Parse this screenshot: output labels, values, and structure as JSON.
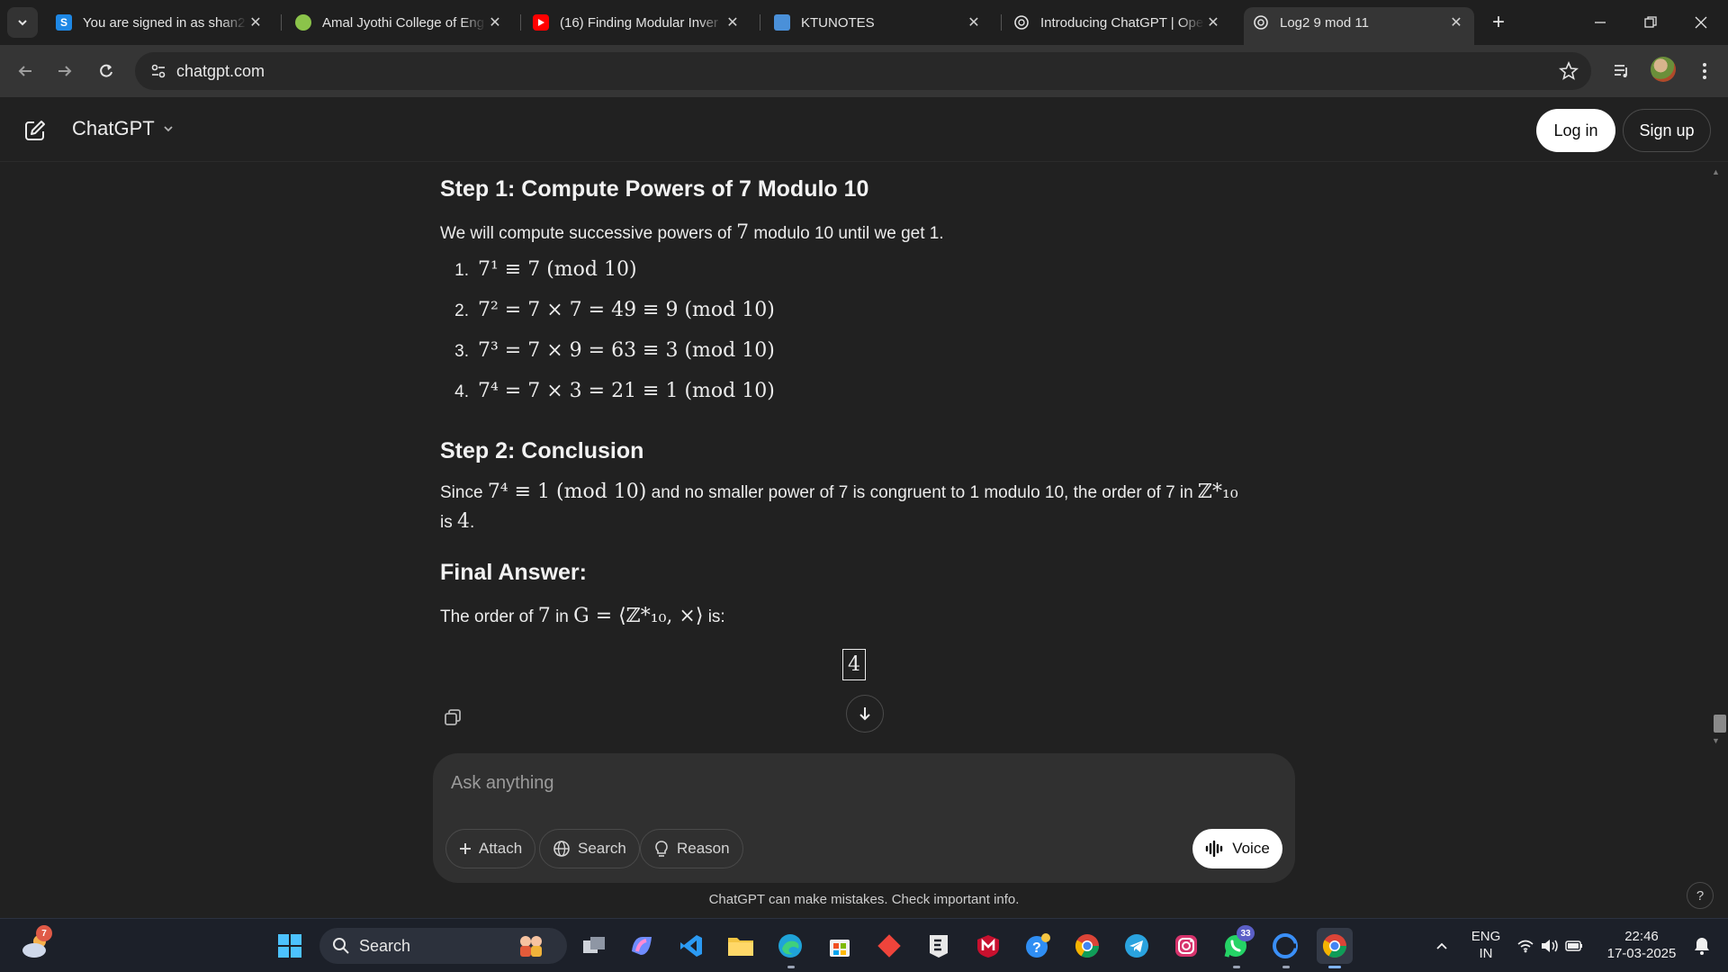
{
  "browser": {
    "tabs": [
      {
        "title": "You are signed in as shan2",
        "favicon": "s-letter-icon",
        "color": "#1e88e5"
      },
      {
        "title": "Amal Jyothi College of Eng",
        "favicon": "college-logo-icon",
        "color": "#8bc34a"
      },
      {
        "title": "(16) Finding Modular Inver",
        "favicon": "youtube-icon",
        "color": "#ff0000"
      },
      {
        "title": "KTUNOTES",
        "favicon": "ktunotes-icon",
        "color": "#4a90d9"
      },
      {
        "title": "Introducing ChatGPT | Ope",
        "favicon": "openai-icon",
        "color": "#ffffff"
      },
      {
        "title": "Log2 9 mod 11",
        "favicon": "openai-icon",
        "color": "#ffffff",
        "active": true
      }
    ],
    "url": "chatgpt.com"
  },
  "header": {
    "brand": "ChatGPT",
    "login_label": "Log in",
    "signup_label": "Sign up"
  },
  "content": {
    "step1_heading": "Step 1: Compute Powers of 7 Modulo 10",
    "step1_intro_pre": "We will compute successive powers of",
    "step1_intro_num": "7",
    "step1_intro_post": "modulo 10 until we get 1.",
    "steps": [
      {
        "n": "1.",
        "math": "7¹ ≡ 7  (mod 10)"
      },
      {
        "n": "2.",
        "math": "7² = 7 × 7 = 49 ≡ 9  (mod 10)"
      },
      {
        "n": "3.",
        "math": "7³ = 7 × 9 = 63 ≡ 3  (mod 10)"
      },
      {
        "n": "4.",
        "math": "7⁴ = 7 × 3 = 21 ≡ 1  (mod 10)"
      }
    ],
    "step2_heading": "Step 2: Conclusion",
    "conclusion_since": "Since",
    "conclusion_math": "7⁴ ≡ 1  (mod 10)",
    "conclusion_text": "and no smaller power of 7 is congruent to 1 modulo 10, the order of 7 in",
    "conclusion_group": "ℤ*₁₀",
    "conclusion_is": "is",
    "conclusion_value": "4",
    "final_heading": "Final Answer:",
    "final_pre": "The order of",
    "final_num": "7",
    "final_in": "in",
    "final_group": "G = ⟨ℤ*₁₀, ×⟩",
    "final_post": "is:",
    "answer": "4"
  },
  "composer": {
    "placeholder": "Ask anything",
    "attach_label": "Attach",
    "search_label": "Search",
    "reason_label": "Reason",
    "voice_label": "Voice"
  },
  "footer": {
    "disclaimer": "ChatGPT can make mistakes. Check important info.",
    "help": "?"
  },
  "taskbar": {
    "weather_badge": "7",
    "search_label": "Search",
    "whatsapp_badge": "33",
    "lang_top": "ENG",
    "lang_bottom": "IN",
    "time": "22:46",
    "date": "17-03-2025"
  }
}
